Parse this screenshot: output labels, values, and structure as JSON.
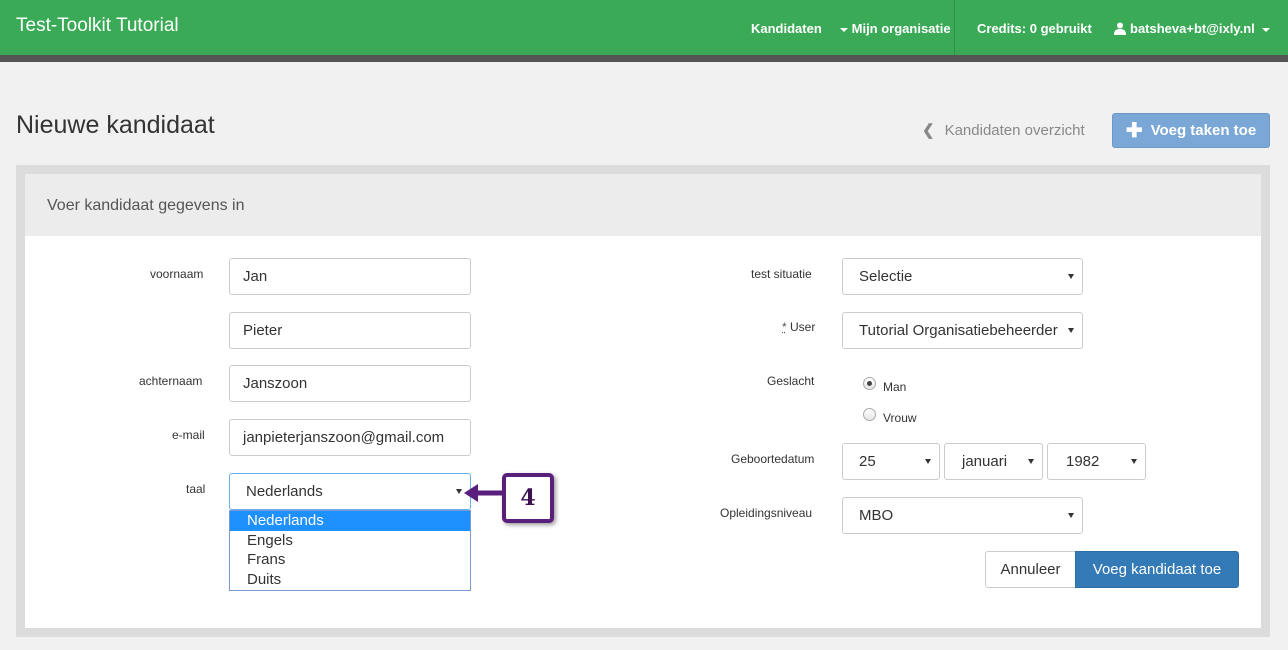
{
  "navbar": {
    "brand": "Test-Toolkit Tutorial",
    "candidates": "Kandidaten",
    "organisation": "Mijn organisatie",
    "credits": "Credits: 0 gebruikt",
    "user": "batsheva+bt@ixly.nl"
  },
  "header": {
    "title": "Nieuwe kandidaat",
    "back_link": "Kandidaten overzicht",
    "add_tasks": "Voeg taken toe"
  },
  "panel": {
    "heading": "Voer kandidaat gegevens in"
  },
  "form": {
    "firstname_label": "voornaam",
    "firstname": "Jan",
    "middlename": "Pieter",
    "lastname_label": "achternaam",
    "lastname": "Janszoon",
    "email_label": "e-mail",
    "email": "janpieterjanszoon@gmail.com",
    "language_label": "taal",
    "language": "Nederlands",
    "language_options": [
      "Nederlands",
      "Engels",
      "Frans",
      "Duits"
    ],
    "test_situation_label": "test situatie",
    "test_situation": "Selectie",
    "user_label_star": "*",
    "user_label": "User",
    "user": "Tutorial Organisatiebeheerder",
    "gender_label": "Geslacht",
    "gender_options": [
      "Man",
      "Vrouw"
    ],
    "gender_selected": "Man",
    "birthdate_label": "Geboortedatum",
    "birth_day": "25",
    "birth_month": "januari",
    "birth_year": "1982",
    "education_label": "Opleidingsniveau",
    "education": "MBO"
  },
  "actions": {
    "cancel": "Annuleer",
    "submit": "Voeg kandidaat toe"
  },
  "annotation": {
    "step": "4",
    "color": "#5a1f7d"
  },
  "colors": {
    "navbar": "#3aaa57",
    "primary_button": "#337ab7",
    "selected_option": "#1e90ff"
  }
}
